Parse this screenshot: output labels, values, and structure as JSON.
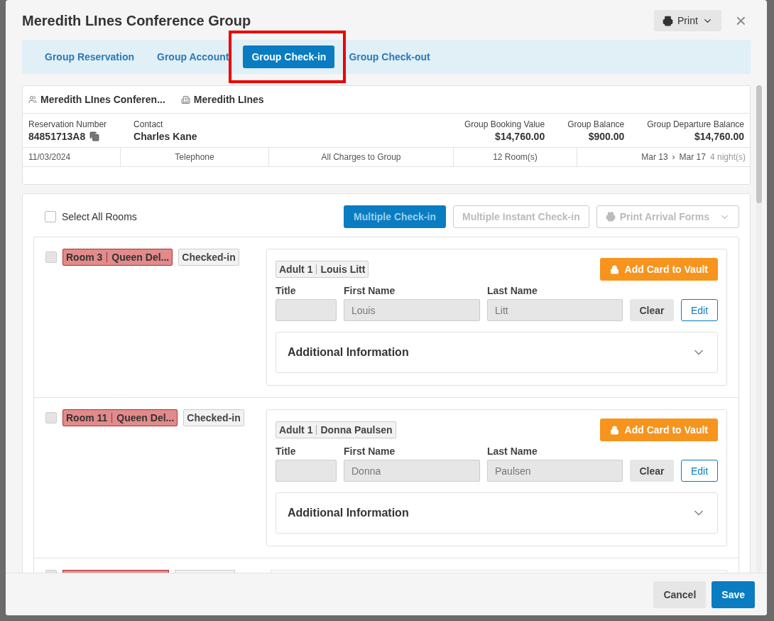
{
  "dialog": {
    "title": "Meredith LInes Conference Group",
    "print_label": "Print",
    "close": "×"
  },
  "tabs": [
    {
      "label": "Group Reservation",
      "selected": false
    },
    {
      "label": "Group Account",
      "selected": false
    },
    {
      "label": "Group Check-in",
      "selected": true,
      "highlighted": true
    },
    {
      "label": "Group Check-out",
      "selected": false
    }
  ],
  "summary": {
    "group_name": "Meredith LInes Conferen...",
    "company": "Meredith LInes",
    "fields": [
      {
        "label": "Reservation Number",
        "value": "84851713A8",
        "kind": "copy"
      },
      {
        "label": "Contact",
        "value": "Charles Kane",
        "kind": "plain"
      }
    ],
    "totals": [
      {
        "label": "Group Booking Value",
        "value": "$14,760.00"
      },
      {
        "label": "Group Balance",
        "value": "$900.00"
      },
      {
        "label": "Group Departure Balance",
        "value": "$14,760.00"
      }
    ],
    "details": [
      "11/03/2024",
      "Telephone",
      "All Charges to Group",
      "12 Room(s)"
    ],
    "arrival": "Mar 13",
    "arrow": "›",
    "departure": "Mar 17",
    "nights": "4 night(s)"
  },
  "toolbar": {
    "select_all": {
      "label": "Select All Rooms",
      "checked": false
    },
    "multiple_checkin": "Multiple Check-in",
    "multiple_instant": "Multiple Instant Check-in",
    "print_forms": "Print Arrival Forms"
  },
  "rooms": [
    {
      "room": "Room 3",
      "type": "Queen Del...",
      "status": "Checked-in",
      "checked": false,
      "guest_type": "Adult 1",
      "guest_name": "Louis Litt",
      "vault": "Add Card to Vault",
      "title_label": "Title",
      "first_label": "First Name",
      "last_label": "Last Name",
      "first": "Louis",
      "last": "Litt",
      "clear": "Clear",
      "edit": "Edit",
      "additional": "Additional Information"
    },
    {
      "room": "Room 11",
      "type": "Queen Del...",
      "status": "Checked-in",
      "checked": false,
      "guest_type": "Adult 1",
      "guest_name": "Donna Paulsen",
      "vault": "Add Card to Vault",
      "title_label": "Title",
      "first_label": "First Name",
      "last_label": "Last Name",
      "first": "Donna",
      "last": "Paulsen",
      "clear": "Clear",
      "edit": "Edit",
      "additional": "Additional Information"
    }
  ],
  "footer": {
    "cancel": "Cancel",
    "save": "Save"
  }
}
